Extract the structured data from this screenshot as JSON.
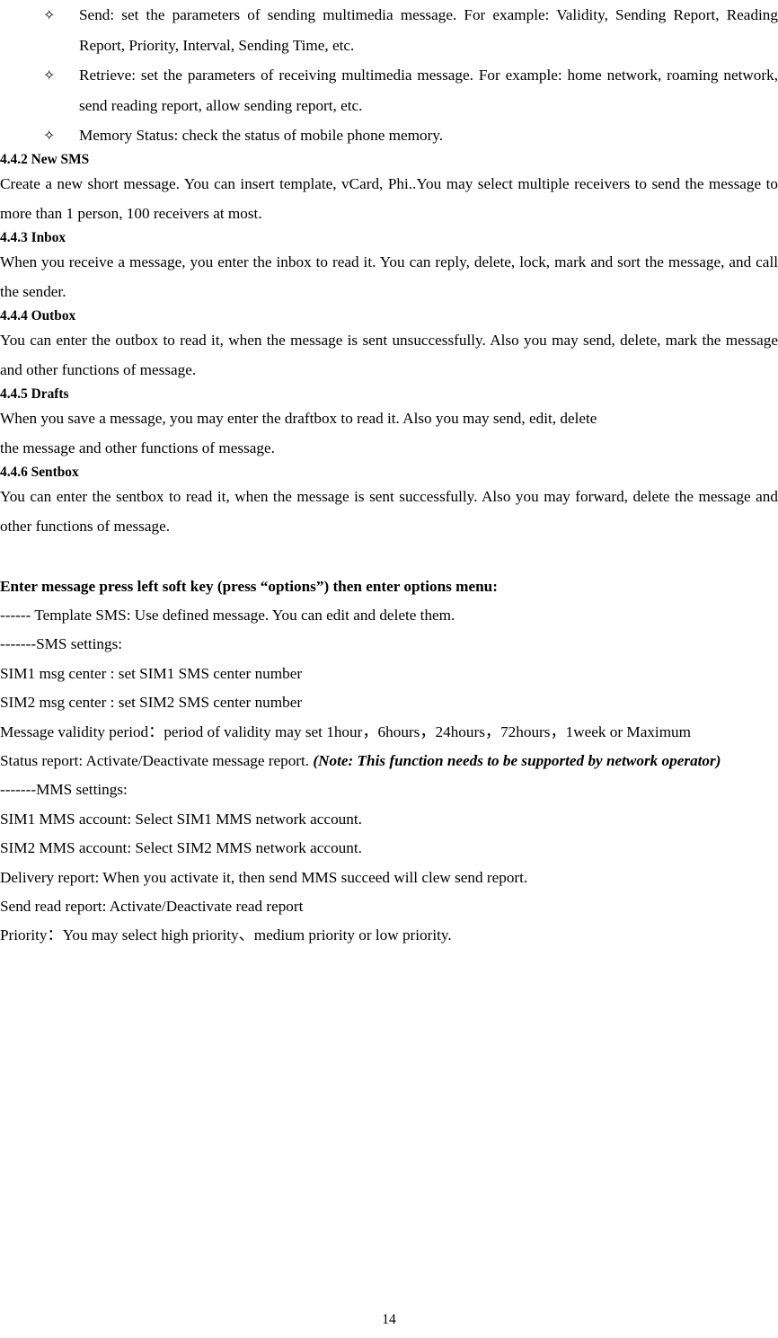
{
  "document": {
    "page_number": "14",
    "bullet_glyph": "✧"
  },
  "bullets": [
    {
      "id": "send",
      "text": "Send: set the parameters of sending multimedia message. For example: Validity, Sending Report, Reading Report, Priority, Interval, Sending Time, etc."
    },
    {
      "id": "retrieve",
      "text": "Retrieve: set the parameters of receiving multimedia message. For example: home network, roaming network, send reading report, allow sending report, etc."
    },
    {
      "id": "memory-status",
      "text": "Memory Status: check the status of mobile phone memory."
    }
  ],
  "sections": [
    {
      "id": "new-sms",
      "heading": "4.4.2 New SMS",
      "body": "Create a new short message. You can insert template, vCard, Phi..You may select multiple receivers to send the message to more than 1 person, 100 receivers at most."
    },
    {
      "id": "inbox",
      "heading": "4.4.3 Inbox",
      "body": "When you receive a message, you enter the inbox to read it. You can reply, delete, lock, mark and sort the message, and call the sender."
    },
    {
      "id": "outbox",
      "heading": "4.4.4 Outbox",
      "body": "You can enter the outbox to read it, when the message is sent unsuccessfully. Also you may send, delete, mark the message and other functions of message."
    },
    {
      "id": "drafts",
      "heading": "4.4.5 Drafts",
      "body_line1": "When you save a message, you may enter the draftbox to read it. Also you may send, edit, delete",
      "body_line2": "the message and other functions of message."
    },
    {
      "id": "sentbox",
      "heading": "4.4.6 Sentbox",
      "body": "You can enter the sentbox to read it, when the message is sent successfully. Also you may forward, delete the message and other functions of message."
    }
  ],
  "options_menu": {
    "heading": "Enter message press left soft key (press “options”) then enter options menu:",
    "lines": [
      "------ Template SMS: Use defined message. You can edit and delete them.",
      "-------SMS settings:",
      "SIM1 msg center : set SIM1 SMS center number",
      "SIM2 msg center : set SIM2 SMS center number"
    ],
    "validity_line": "Message validity period：period of validity may set 1hour，6hours，24hours，72hours，1week or Maximum",
    "status_report": {
      "plain": "Status report: Activate/Deactivate message report. ",
      "note": "(Note: This function needs to be supported by network operator)"
    },
    "mms_lines": [
      "-------MMS settings:",
      "SIM1 MMS account: Select SIM1 MMS network account.",
      "SIM2 MMS account: Select SIM2 MMS network account.",
      "Delivery report: When you activate it, then send MMS succeed will clew send report.",
      "Send read report: Activate/Deactivate read report",
      "Priority：You may select high priority、medium priority or low priority."
    ]
  }
}
